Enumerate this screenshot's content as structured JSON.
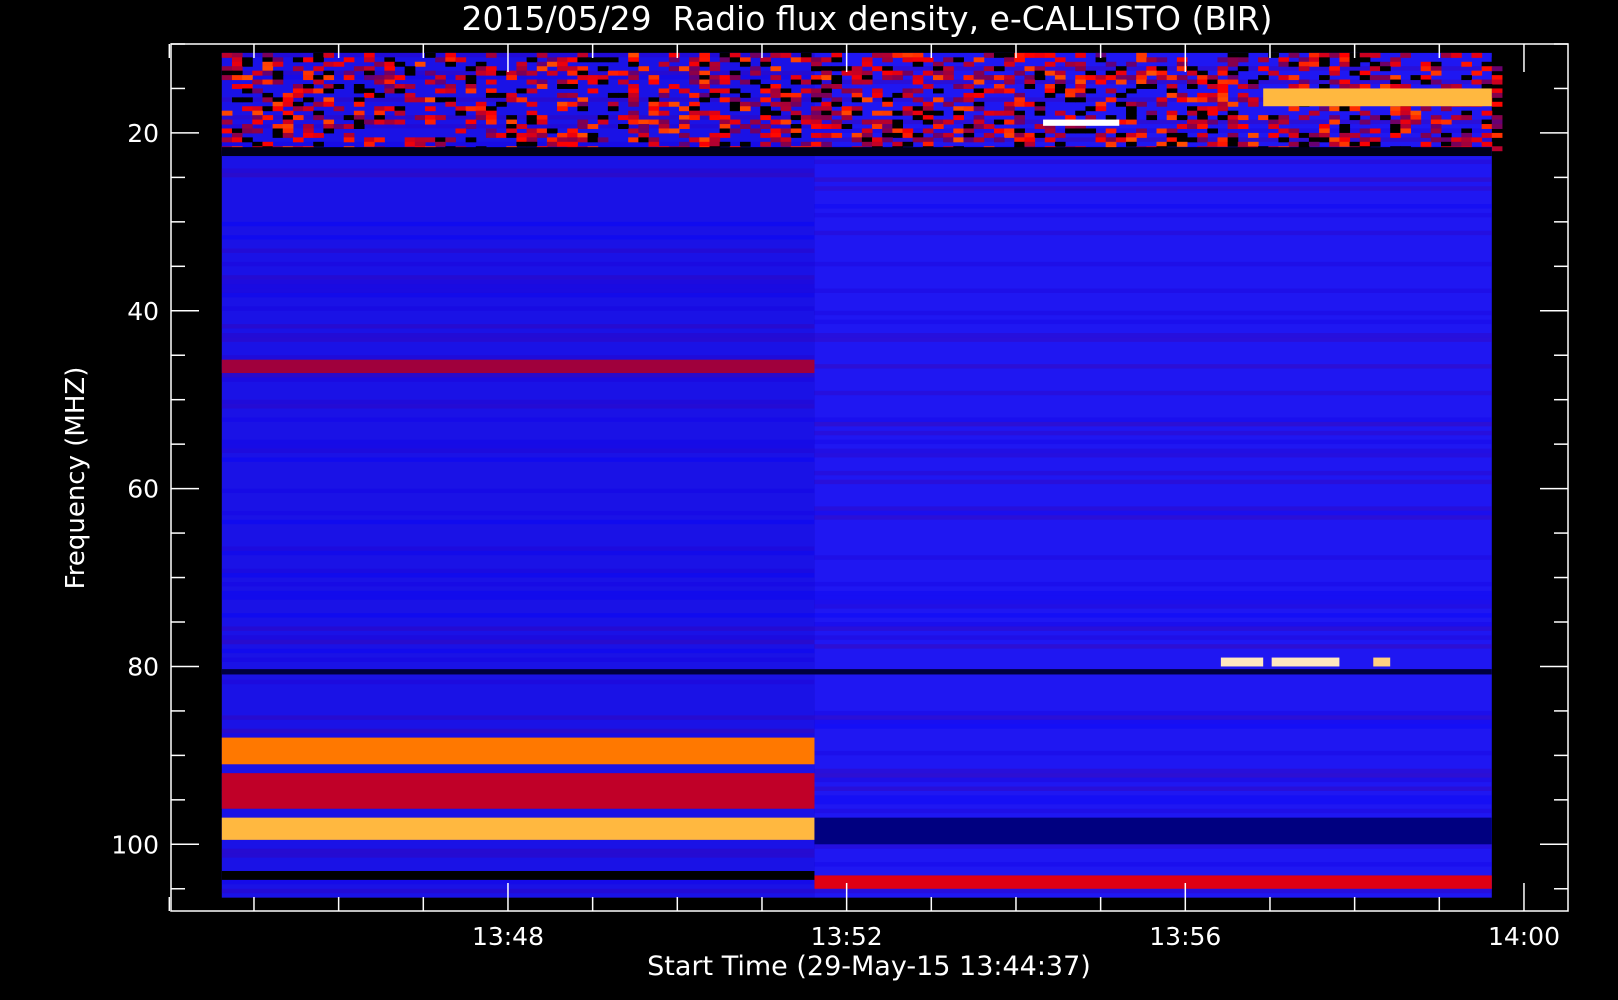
{
  "chart_data": {
    "type": "heatmap",
    "title": "2015/05/29  Radio flux density, e-CALLISTO (BIR)",
    "xlabel": "Start Time (29-May-15 13:44:37)",
    "ylabel": "Frequency (MHZ)",
    "x_unit": "minutes after 13:44:37",
    "xlim": [
      -0.6,
      15.9
    ],
    "ylim": [
      107.5,
      10
    ],
    "x_ticks": [
      {
        "label": "13:48",
        "value": 3.38
      },
      {
        "label": "13:52",
        "value": 7.38
      },
      {
        "label": "13:56",
        "value": 11.38
      },
      {
        "label": "14:00",
        "value": 15.38
      }
    ],
    "x_minor_step": 1,
    "y_ticks": [
      20,
      40,
      60,
      80,
      100
    ],
    "y_minor_step": 5,
    "data_extent": {
      "x": [
        0,
        15.0
      ],
      "y": [
        11,
        106
      ]
    },
    "colormap": [
      "#000000",
      "#0000ff",
      "#800050",
      "#ff0000",
      "#ffa000",
      "#ffffff"
    ],
    "colors": {
      "background": "#000000",
      "axes": "#ffffff",
      "base_left": "#1a12e6",
      "base_right": "#1f17f2"
    },
    "features": [
      {
        "label": "noisy high-intensity band",
        "x": [
          0,
          15.0
        ],
        "y": [
          11,
          22
        ],
        "intensity": 0.7
      },
      {
        "label": "dark band",
        "x": [
          0,
          15.0
        ],
        "y": [
          21.6,
          22.6
        ],
        "intensity": 0.02
      },
      {
        "label": "faint red band",
        "x": [
          0,
          7.0
        ],
        "y": [
          45.5,
          47
        ],
        "intensity": 0.45
      },
      {
        "label": "interference line",
        "x": [
          0,
          15.0
        ],
        "y": [
          80.3,
          80.9
        ],
        "intensity": 0.05
      },
      {
        "label": "red band",
        "x": [
          0,
          7.0
        ],
        "y": [
          88,
          91
        ],
        "intensity": 0.75
      },
      {
        "label": "red band",
        "x": [
          0,
          7.0
        ],
        "y": [
          92,
          96
        ],
        "intensity": 0.5
      },
      {
        "label": "bright red band",
        "x": [
          0,
          7.0
        ],
        "y": [
          97,
          99.5
        ],
        "intensity": 0.85
      },
      {
        "label": "dark band",
        "x": [
          7.0,
          15.0
        ],
        "y": [
          97,
          100
        ],
        "intensity": 0.1
      },
      {
        "label": "dark band",
        "x": [
          0,
          7.0
        ],
        "y": [
          103,
          104
        ],
        "intensity": 0.0
      },
      {
        "label": "red band",
        "x": [
          7.0,
          15.0
        ],
        "y": [
          103.5,
          105
        ],
        "intensity": 0.55
      },
      {
        "label": "burst",
        "x": [
          11.8,
          12.3
        ],
        "y": [
          79,
          80
        ],
        "intensity": 0.95
      },
      {
        "label": "burst",
        "x": [
          12.4,
          13.2
        ],
        "y": [
          79,
          80
        ],
        "intensity": 0.95
      },
      {
        "label": "burst",
        "x": [
          13.6,
          13.8
        ],
        "y": [
          79,
          80
        ],
        "intensity": 0.9
      },
      {
        "label": "burst",
        "x": [
          9.7,
          10.6
        ],
        "y": [
          18.5,
          19.2
        ],
        "intensity": 1.0
      },
      {
        "label": "burst",
        "x": [
          12.3,
          15.0
        ],
        "y": [
          15,
          17
        ],
        "intensity": 0.85
      }
    ]
  }
}
